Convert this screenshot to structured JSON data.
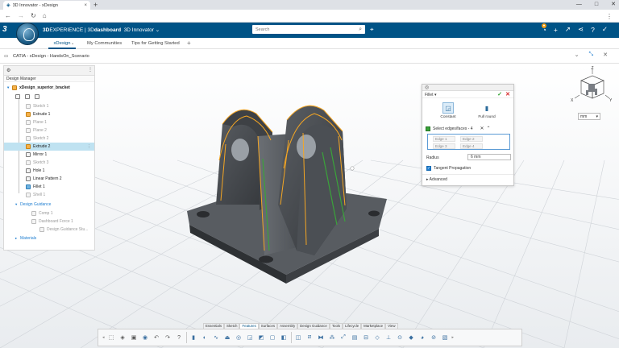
{
  "browser": {
    "tab_title": "3D Innovator - xDesign",
    "tab_close": "×",
    "new_tab": "+",
    "window_controls": [
      "—",
      "□",
      "✕"
    ]
  },
  "appbar": {
    "brand_prefix": "3D",
    "brand_experience": "EXPERIENCE | 3D",
    "brand_dashboard": "dashboard",
    "brand_app": "3D Innovator",
    "search_placeholder": "Search",
    "icons": [
      "chat-icon",
      "plus-icon",
      "share-icon",
      "share-alt-icon",
      "help-icon",
      "apps-icon"
    ]
  },
  "subtabs": {
    "items": [
      "xDesign",
      "My Communities",
      "Tips for Getting Started"
    ],
    "active": "xDesign",
    "add": "+"
  },
  "document": {
    "title": "CATIA - xDesign - HandsOn_Scenario"
  },
  "tree": {
    "heading": "Design Manager",
    "rows": [
      {
        "label": "xDesign_superior_bracket",
        "state": "normal",
        "bold": true
      },
      {
        "label": "Sketch 1",
        "state": "dim"
      },
      {
        "label": "Extrude 1",
        "state": "normal"
      },
      {
        "label": "Plane 1",
        "state": "dim"
      },
      {
        "label": "Plane 2",
        "state": "dim"
      },
      {
        "label": "Sketch 2",
        "state": "dim"
      },
      {
        "label": "Extrude 2",
        "state": "selected"
      },
      {
        "label": "Mirror 1",
        "state": "normal"
      },
      {
        "label": "Sketch 3",
        "state": "dim"
      },
      {
        "label": "Hole 1",
        "state": "normal"
      },
      {
        "label": "Linear Pattern 2",
        "state": "normal"
      },
      {
        "label": "Fillet 1",
        "state": "normal"
      },
      {
        "label": "Shell 1",
        "state": "dim"
      },
      {
        "label": "Design Guidance",
        "state": "blue"
      },
      {
        "label": "Comp 1",
        "state": "dim"
      },
      {
        "label": "Dashboard Force 1",
        "state": "dim"
      },
      {
        "label": "Design Guidance Stu...",
        "state": "dim"
      },
      {
        "label": "Materials",
        "state": "blue"
      }
    ]
  },
  "fillet": {
    "title": "Fillet",
    "mode_constant": "Constant",
    "mode_full_round": "Full round",
    "selection_label": "Select edges/faces - 4",
    "edges": [
      "Edge 1",
      "Edge 2",
      "Edge 3",
      "Edge 4"
    ],
    "radius_label": "Radius",
    "radius_value": "6 mm",
    "tangent_label": "Tangent Propagation",
    "advanced_label": "Advanced"
  },
  "viewcube": {
    "axis_z": "Z",
    "axis_x": "X",
    "axis_y": "Y"
  },
  "units": {
    "value": "mm"
  },
  "action_tabs": {
    "items": [
      "Essentials",
      "Sketch",
      "Features",
      "Surfaces",
      "Assembly",
      "Design Guidance",
      "Tools",
      "Lifecycle",
      "Marketplace",
      "View"
    ],
    "active": "Features"
  },
  "colors": {
    "appbar": "#005386",
    "selection": "#bfe2f1",
    "model": "#4b4f55",
    "highlight_orange": "#f5a623",
    "highlight_green": "#3aa33a"
  }
}
